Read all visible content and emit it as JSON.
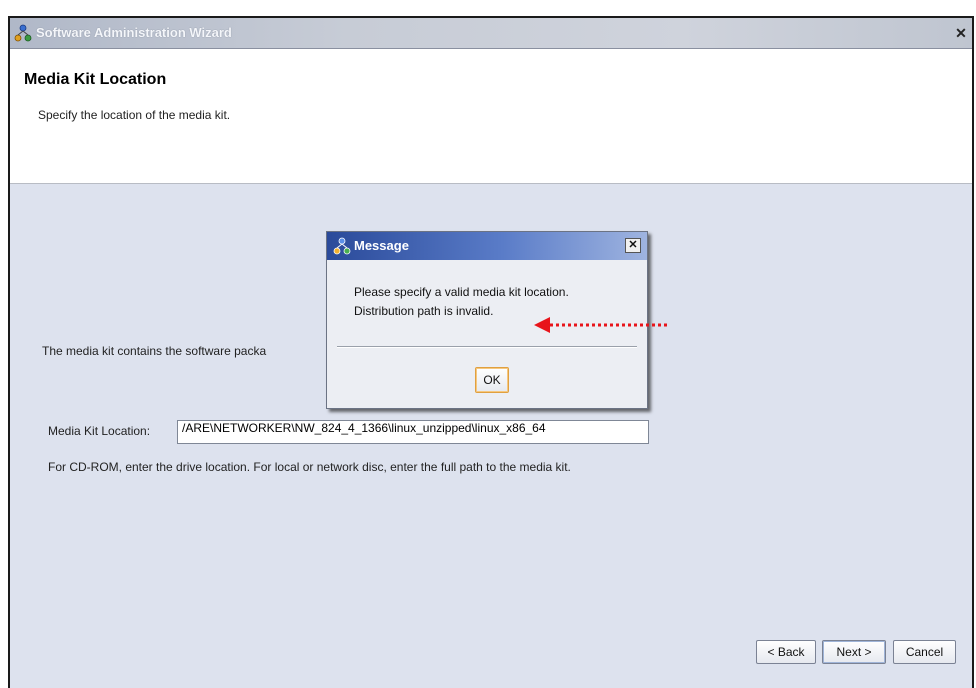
{
  "window": {
    "title": "Software Administration Wizard",
    "close_glyph": "✕"
  },
  "header": {
    "title": "Media Kit Location",
    "subtitle": "Specify the location of the media kit."
  },
  "body": {
    "info_text": "The media kit contains the software packa",
    "location_label": "Media Kit Location:",
    "location_value": "/ARE\\NETWORKER\\NW_824_4_1366\\linux_unzipped\\linux_x86_64",
    "hint_text": "For CD-ROM, enter the drive location. For local or network disc, enter the full path to the media kit."
  },
  "footer": {
    "back_label": "< Back",
    "next_label": "Next >",
    "cancel_label": "Cancel"
  },
  "dialog": {
    "title": "Message",
    "line1": "Please specify a valid media kit location.",
    "line2": "Distribution path is invalid.",
    "ok_label": "OK",
    "close_glyph": "✕"
  },
  "icons": {
    "app": "network-nodes-icon",
    "dialog": "network-nodes-icon",
    "annotation": "red-dotted-arrow-icon"
  },
  "colors": {
    "annotation_arrow": "#e8141a",
    "dialog_title": "#2a4a9a",
    "panel_background": "#dde2ee"
  }
}
